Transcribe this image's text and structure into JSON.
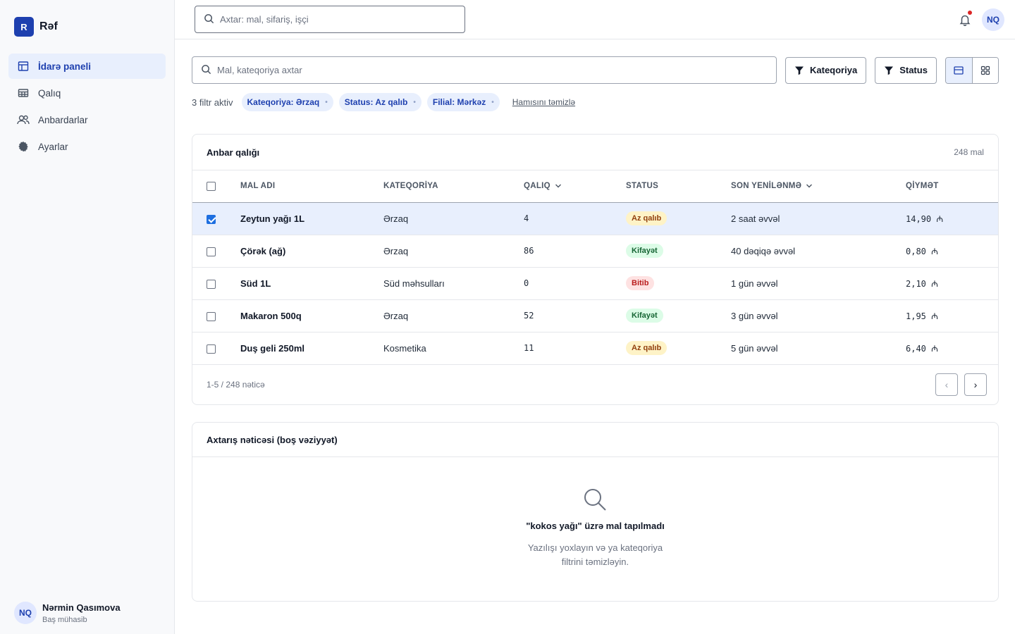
{
  "brand": {
    "logo_letter": "R",
    "name": "Rəf",
    "accent": "#1e40af"
  },
  "sidebar": {
    "items": [
      {
        "label": "İdarə paneli",
        "icon": "dashboard-icon",
        "active": true
      },
      {
        "label": "Qalıq",
        "icon": "table-icon",
        "active": false
      },
      {
        "label": "Anbardarlar",
        "icon": "users-icon",
        "active": false
      },
      {
        "label": "Ayarlar",
        "icon": "gear-icon",
        "active": false
      }
    ],
    "user": {
      "initials": "NQ",
      "name": "Nərmin Qasımova",
      "role": "Baş mühasib"
    }
  },
  "topbar": {
    "search_placeholder": "Axtar: mal, sifariş, işçi",
    "avatar_initials": "NQ",
    "has_notification": true
  },
  "filters": {
    "search_placeholder": "Mal, kateqoriya axtar",
    "category_label": "Kateqoriya",
    "status_label": "Status",
    "active_count_label": "3 filtr aktiv",
    "chips": [
      "Kateqoriya: Ərzaq",
      "Status: Az qalıb",
      "Filial: Mərkəz"
    ],
    "clear_all_label": "Hamısını təmizlə"
  },
  "inventory": {
    "title": "Anbar qalığı",
    "count_label": "248 mal",
    "columns": [
      "MAL ADI",
      "KATEQORİYA",
      "QALIQ",
      "STATUS",
      "SON YENİLƏNMƏ",
      "QİYMƏT"
    ],
    "rows": [
      {
        "name": "Zeytun yağı 1L",
        "category": "Ərzaq",
        "qty": "4",
        "status": "Az qalıb",
        "status_type": "warn",
        "updated": "2 saat əvvəl",
        "price": "14,90 ₼",
        "selected": true
      },
      {
        "name": "Çörək (ağ)",
        "category": "Ərzaq",
        "qty": "86",
        "status": "Kifayət",
        "status_type": "ok",
        "updated": "40 dəqiqə əvvəl",
        "price": "0,80 ₼",
        "selected": false
      },
      {
        "name": "Süd 1L",
        "category": "Süd məhsulları",
        "qty": "0",
        "status": "Bitib",
        "status_type": "bad",
        "updated": "1 gün əvvəl",
        "price": "2,10 ₼",
        "selected": false
      },
      {
        "name": "Makaron 500q",
        "category": "Ərzaq",
        "qty": "52",
        "status": "Kifayət",
        "status_type": "ok",
        "updated": "3 gün əvvəl",
        "price": "1,95 ₼",
        "selected": false
      },
      {
        "name": "Duş geli 250ml",
        "category": "Kosmetika",
        "qty": "11",
        "status": "Az qalıb",
        "status_type": "warn",
        "updated": "5 gün əvvəl",
        "price": "6,40 ₼",
        "selected": false
      }
    ],
    "footer_label": "1-5 / 248 nəticə",
    "prev_label": "‹",
    "next_label": "›"
  },
  "empty_state": {
    "title": "Axtarış nəticəsi (boş vəziyyət)",
    "icon": "search-icon",
    "message": "\"kokos yağı\" üzrə mal tapılmadı",
    "description": "Yazılışı yoxlayın və ya kateqoriya filtrini təmizləyin."
  }
}
